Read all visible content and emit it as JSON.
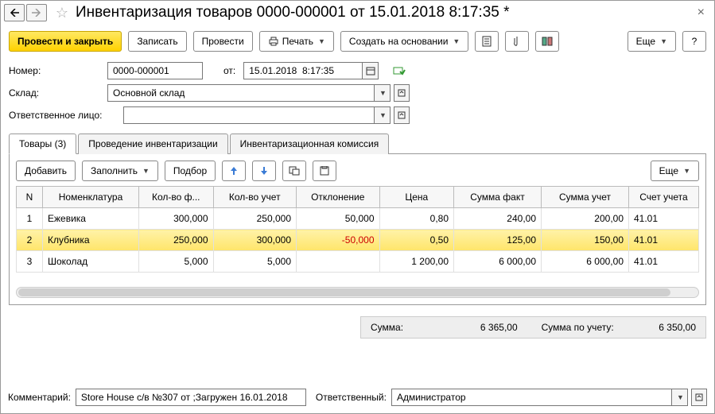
{
  "title": "Инвентаризация товаров 0000-000001 от 15.01.2018 8:17:35 *",
  "toolbar": {
    "post_close": "Провести и закрыть",
    "save": "Записать",
    "post": "Провести",
    "print": "Печать",
    "create_based": "Создать на основании",
    "more": "Еще",
    "help": "?"
  },
  "form": {
    "number_label": "Номер:",
    "number": "0000-000001",
    "date_label": "от:",
    "date": "15.01.2018  8:17:35",
    "warehouse_label": "Склад:",
    "warehouse": "Основной склад",
    "responsible_label": "Ответственное лицо:",
    "responsible": ""
  },
  "tabs": {
    "goods": "Товары (3)",
    "conduct": "Проведение инвентаризации",
    "commission": "Инвентаризационная комиссия"
  },
  "grid_toolbar": {
    "add": "Добавить",
    "fill": "Заполнить",
    "select": "Подбор",
    "more": "Еще"
  },
  "columns": {
    "n": "N",
    "nom": "Номенклатура",
    "qty_fact": "Кол-во ф...",
    "qty_acc": "Кол-во учет",
    "dev": "Отклонение",
    "price": "Цена",
    "sum_fact": "Сумма факт",
    "sum_acc": "Сумма учет",
    "acc": "Счет учета"
  },
  "rows": [
    {
      "n": "1",
      "nom": "Ежевика",
      "qty_fact": "300,000",
      "qty_acc": "250,000",
      "dev": "50,000",
      "price": "0,80",
      "sum_fact": "240,00",
      "sum_acc": "200,00",
      "acc": "41.01",
      "sel": false
    },
    {
      "n": "2",
      "nom": "Клубника",
      "qty_fact": "250,000",
      "qty_acc": "300,000",
      "dev": "-50,000",
      "price": "0,50",
      "sum_fact": "125,00",
      "sum_acc": "150,00",
      "acc": "41.01",
      "sel": true,
      "neg": true
    },
    {
      "n": "3",
      "nom": "Шоколад",
      "qty_fact": "5,000",
      "qty_acc": "5,000",
      "dev": "",
      "price": "1 200,00",
      "sum_fact": "6 000,00",
      "sum_acc": "6 000,00",
      "acc": "41.01",
      "sel": false
    }
  ],
  "totals": {
    "sum_label": "Сумма:",
    "sum": "6 365,00",
    "sum_acc_label": "Сумма по учету:",
    "sum_acc": "6 350,00"
  },
  "footer": {
    "comment_label": "Комментарий:",
    "comment": "Store House с/в №307 от ;Загружен 16.01.2018",
    "resp_label": "Ответственный:",
    "resp": "Администратор"
  }
}
